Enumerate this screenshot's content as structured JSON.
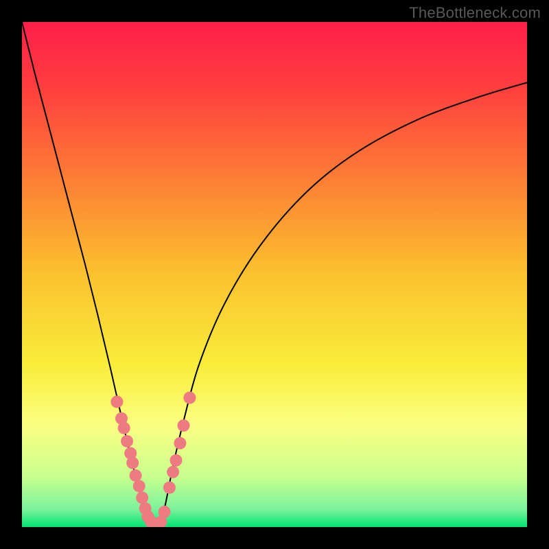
{
  "watermark": "TheBottleneck.com",
  "chart_data": {
    "type": "line",
    "title": "",
    "xlabel": "",
    "ylabel": "",
    "xlim": [
      0,
      1
    ],
    "ylim": [
      0,
      1
    ],
    "annotations": [],
    "background": {
      "kind": "vertical-gradient",
      "stops": [
        {
          "pos": 0.0,
          "color": "#ff1f4a"
        },
        {
          "pos": 0.12,
          "color": "#ff3b3f"
        },
        {
          "pos": 0.3,
          "color": "#fd7a35"
        },
        {
          "pos": 0.5,
          "color": "#fbc22e"
        },
        {
          "pos": 0.68,
          "color": "#f9ed3a"
        },
        {
          "pos": 0.8,
          "color": "#faff82"
        },
        {
          "pos": 0.9,
          "color": "#c8ff8e"
        },
        {
          "pos": 0.965,
          "color": "#7cf29b"
        },
        {
          "pos": 1.0,
          "color": "#00e472"
        }
      ]
    },
    "series": [
      {
        "name": "bottleneck-curve",
        "kind": "curve",
        "color": "#000000",
        "width": 2,
        "x": [
          0.0,
          0.025,
          0.05,
          0.075,
          0.1,
          0.125,
          0.15,
          0.175,
          0.2,
          0.22,
          0.24,
          0.252,
          0.265,
          0.275,
          0.285,
          0.3,
          0.32,
          0.35,
          0.4,
          0.47,
          0.56,
          0.66,
          0.78,
          0.9,
          1.0
        ],
        "y": [
          1.0,
          0.9,
          0.805,
          0.71,
          0.615,
          0.52,
          0.42,
          0.315,
          0.205,
          0.12,
          0.05,
          0.01,
          0.0,
          0.01,
          0.05,
          0.125,
          0.21,
          0.32,
          0.44,
          0.555,
          0.66,
          0.74,
          0.805,
          0.85,
          0.88
        ]
      },
      {
        "name": "highlight-dots",
        "kind": "scatter",
        "color": "#ee7b82",
        "radius": 9,
        "points": [
          {
            "x": 0.188,
            "y": 0.248
          },
          {
            "x": 0.197,
            "y": 0.215
          },
          {
            "x": 0.202,
            "y": 0.196
          },
          {
            "x": 0.208,
            "y": 0.17
          },
          {
            "x": 0.215,
            "y": 0.146
          },
          {
            "x": 0.219,
            "y": 0.127
          },
          {
            "x": 0.225,
            "y": 0.102
          },
          {
            "x": 0.232,
            "y": 0.081
          },
          {
            "x": 0.238,
            "y": 0.058
          },
          {
            "x": 0.244,
            "y": 0.037
          },
          {
            "x": 0.249,
            "y": 0.021
          },
          {
            "x": 0.255,
            "y": 0.011
          },
          {
            "x": 0.261,
            "y": 0.003
          },
          {
            "x": 0.268,
            "y": 0.003
          },
          {
            "x": 0.275,
            "y": 0.01
          },
          {
            "x": 0.282,
            "y": 0.03
          },
          {
            "x": 0.292,
            "y": 0.078
          },
          {
            "x": 0.299,
            "y": 0.109
          },
          {
            "x": 0.305,
            "y": 0.132
          },
          {
            "x": 0.313,
            "y": 0.166
          },
          {
            "x": 0.32,
            "y": 0.201
          },
          {
            "x": 0.332,
            "y": 0.256
          }
        ]
      }
    ]
  }
}
